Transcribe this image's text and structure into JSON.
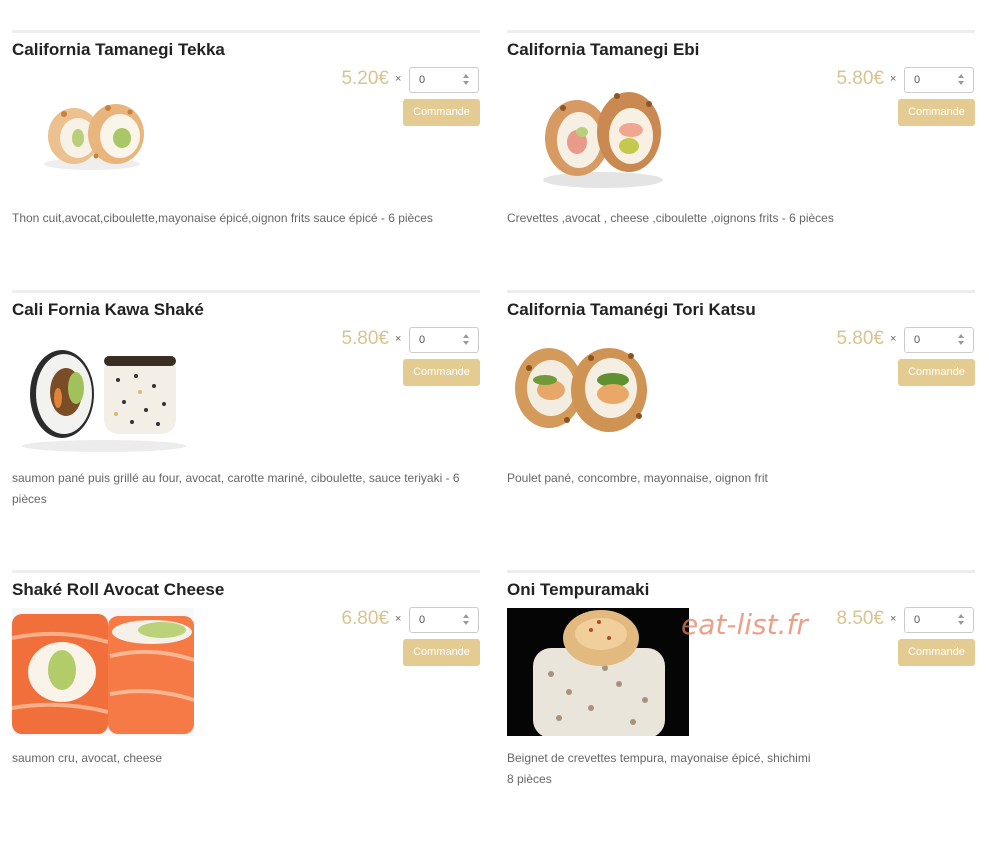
{
  "products": [
    {
      "title": "California Tamanegi Tekka",
      "price": "5.20€",
      "times": "×",
      "quantity": "0",
      "button": "Commande",
      "description": "Thon cuit,avocat,ciboulette,mayonaise épicé,oignon frits sauce épicé - 6 pièces"
    },
    {
      "title": "California Tamanegi Ebi",
      "price": "5.80€",
      "times": "×",
      "quantity": "0",
      "button": "Commande",
      "description": "Crevettes ,avocat , cheese ,ciboulette ,oignons frits - 6 pièces"
    },
    {
      "title": "Cali Fornia Kawa Shaké",
      "price": "5.80€",
      "times": "×",
      "quantity": "0",
      "button": "Commande",
      "description": "saumon pané puis grillé au four, avocat, carotte mariné, ciboulette, sauce teriyaki - 6 pièces"
    },
    {
      "title": "California Tamanégi Tori Katsu",
      "price": "5.80€",
      "times": "×",
      "quantity": "0",
      "button": "Commande",
      "description": "Poulet pané, concombre, mayonnaise, oignon frit"
    },
    {
      "title": "Shaké Roll Avocat Cheese",
      "price": "6.80€",
      "times": "×",
      "quantity": "0",
      "button": "Commande",
      "description": "saumon cru, avocat, cheese"
    },
    {
      "title": "Oni Tempuramaki",
      "price": "8.50€",
      "times": "×",
      "quantity": "0",
      "button": "Commande",
      "description_line1": "Beignet de crevettes tempura, mayonaise épicé, shichimi",
      "description_line2": "8 pièces"
    }
  ],
  "watermark": "eat-list.fr",
  "colors": {
    "price": "#d9c48f",
    "button": "#e3cb92",
    "title": "#222222",
    "description": "#666666"
  }
}
